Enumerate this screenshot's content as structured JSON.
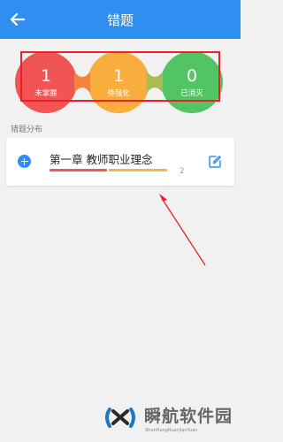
{
  "header": {
    "title": "错题"
  },
  "stats": [
    {
      "value": "1",
      "label": "未掌握",
      "color": "#f05454"
    },
    {
      "value": "1",
      "label": "待强化",
      "color": "#f8ad3c"
    },
    {
      "value": "0",
      "label": "已消灭",
      "color": "#53c464"
    }
  ],
  "section_title": "错题分布",
  "chapters": [
    {
      "title": "第一章 教师职业理念",
      "count": "2",
      "not_mastered": 1,
      "to_strengthen": 1,
      "eliminated": 0
    }
  ],
  "watermark": {
    "main": "瞬航软件园",
    "sub": "ShunHangRuanJianYuan"
  },
  "colors": {
    "primary": "#2f8ff0",
    "highlight": "#e8202a",
    "background": "#f1f1f1"
  }
}
